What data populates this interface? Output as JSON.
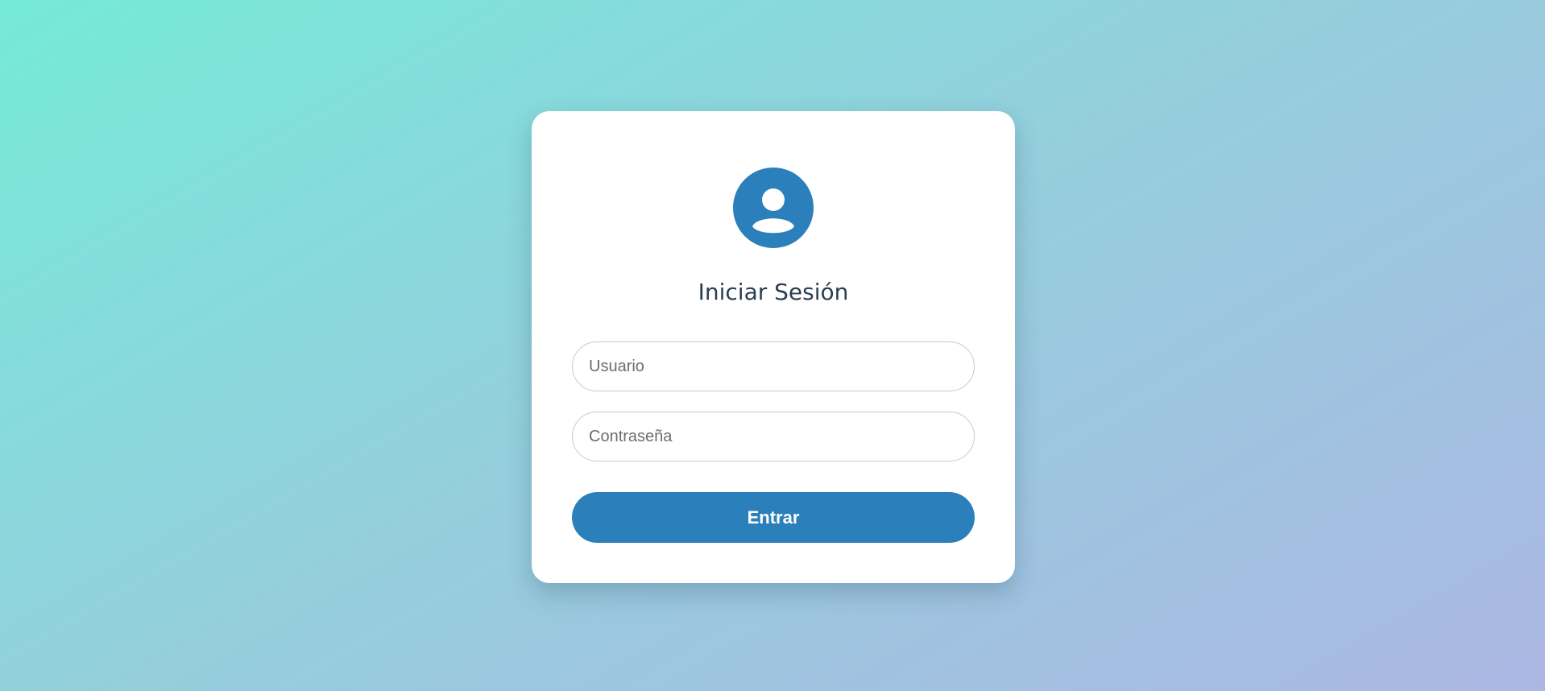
{
  "login": {
    "avatar_icon": "user-circle-icon",
    "title": "Iniciar Sesión",
    "username": {
      "value": "",
      "placeholder": "Usuario"
    },
    "password": {
      "value": "",
      "placeholder": "Contraseña"
    },
    "submit_label": "Entrar"
  },
  "colors": {
    "accent": "#2b80bb",
    "title_text": "#2c3e50",
    "background_start": "#75ead8",
    "background_end": "#abb7e3",
    "card": "#ffffff"
  }
}
